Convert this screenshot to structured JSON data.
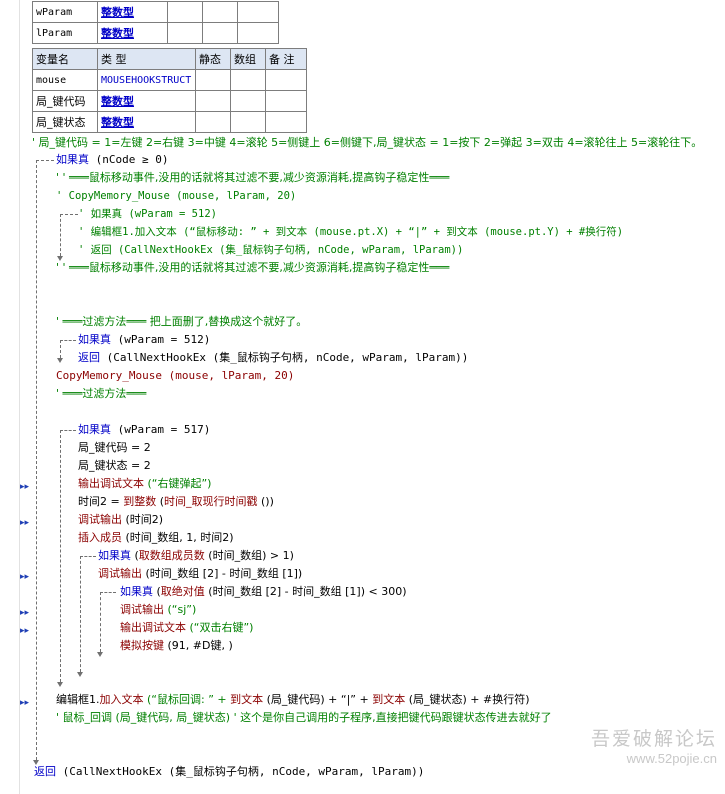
{
  "params_table": {
    "rows": [
      {
        "name": "wParam",
        "type": "整数型"
      },
      {
        "name": "lParam",
        "type": "整数型"
      }
    ]
  },
  "vars_table": {
    "headers": [
      "变量名",
      "类 型",
      "静态",
      "数组",
      "备 注"
    ],
    "rows": [
      {
        "name": "mouse",
        "type": "MOUSEHOOKSTRUCT"
      },
      {
        "name": "局_键代码",
        "type": "整数型"
      },
      {
        "name": "局_键状态",
        "type": "整数型"
      }
    ]
  },
  "code": {
    "l01": "' 局_键代码 = 1=左键 2=右键 3=中键 4=滚轮 5=侧键上 6=侧键下,局_键状态 = 1=按下 2=弹起 3=双击 4=滚轮往上 5=滚轮往下。",
    "l02_kw": "如果真",
    "l02_rest": " (nCode ≥ 0)",
    "l03": "' ' ═══鼠标移动事件,没用的话就将其过滤不要,减少资源消耗,提高钩子稳定性═══",
    "l04": "' CopyMemory_Mouse (mouse, lParam, 20)",
    "l05": "' 如果真 (wParam = 512)",
    "l06": "' 编辑框1.加入文本 (“鼠标移动: ” + 到文本 (mouse.pt.X) + “|” + 到文本 (mouse.pt.Y) + #换行符)",
    "l07": "' 返回 (CallNextHookEx (集_鼠标钩子句柄, nCode, wParam, lParam))",
    "l08": "' ' ═══鼠标移动事件,没用的话就将其过滤不要,减少资源消耗,提高钩子稳定性═══",
    "l09": "' ═══过滤方法═══  把上面删了,替换成这个就好了。",
    "l10_kw": "如果真",
    "l10_rest": " (wParam = 512)",
    "l11_kw": "返回",
    "l11_rest": " (CallNextHookEx (集_鼠标钩子句柄, nCode, wParam, lParam))",
    "l12": "CopyMemory_Mouse (mouse, lParam, 20)",
    "l13": "' ═══过滤方法═══",
    "l14_kw": "如果真",
    "l14_rest": " (wParam = 517)",
    "l15": "局_键代码 = 2",
    "l16": "局_键状态 = 2",
    "l17_fn": "输出调试文本",
    "l17_rest": " (“右键弹起”)",
    "l18_a": "时间2 = ",
    "l18_fn": "到整数",
    "l18_b": " (",
    "l18_fn2": "时间_取现行时间戳",
    "l18_c": " ())",
    "l19_fn": "调试输出",
    "l19_rest": " (时间2)",
    "l20_fn": "插入成员",
    "l20_rest": " (时间_数组, 1, 时间2)",
    "l21_kw": "如果真",
    "l21_a": " (",
    "l21_fn": "取数组成员数",
    "l21_rest": " (时间_数组) > 1)",
    "l22_fn": "调试输出",
    "l22_rest": " (时间_数组 [2] - 时间_数组 [1])",
    "l23_kw": "如果真",
    "l23_a": " (",
    "l23_fn": "取绝对值",
    "l23_rest": " (时间_数组 [2] - 时间_数组 [1]) < 300)",
    "l24_fn": "调试输出",
    "l24_rest": " (“sj”)",
    "l25_fn": "输出调试文本",
    "l25_rest": " (“双击右键”)",
    "l26_fn": "模拟按键",
    "l26_rest": " (91, #D键, )",
    "l27_a": "编辑框1.",
    "l27_fn": "加入文本",
    "l27_b": " (“鼠标回调: ” + ",
    "l27_fn2": "到文本",
    "l27_c": " (局_键代码) + “|” + ",
    "l27_fn3": "到文本",
    "l27_d": " (局_键状态) + #换行符)",
    "l28": "' 鼠标_回调 (局_键代码, 局_键状态) ' 这个是你自己调用的子程序,直接把键代码跟键状态传进去就好了",
    "l29_kw": "返回",
    "l29_rest": " (CallNextHookEx (集_鼠标钩子句柄, nCode, wParam, lParam))"
  },
  "watermark": {
    "title": "吾爱破解论坛",
    "url": "www.52pojie.cn"
  }
}
